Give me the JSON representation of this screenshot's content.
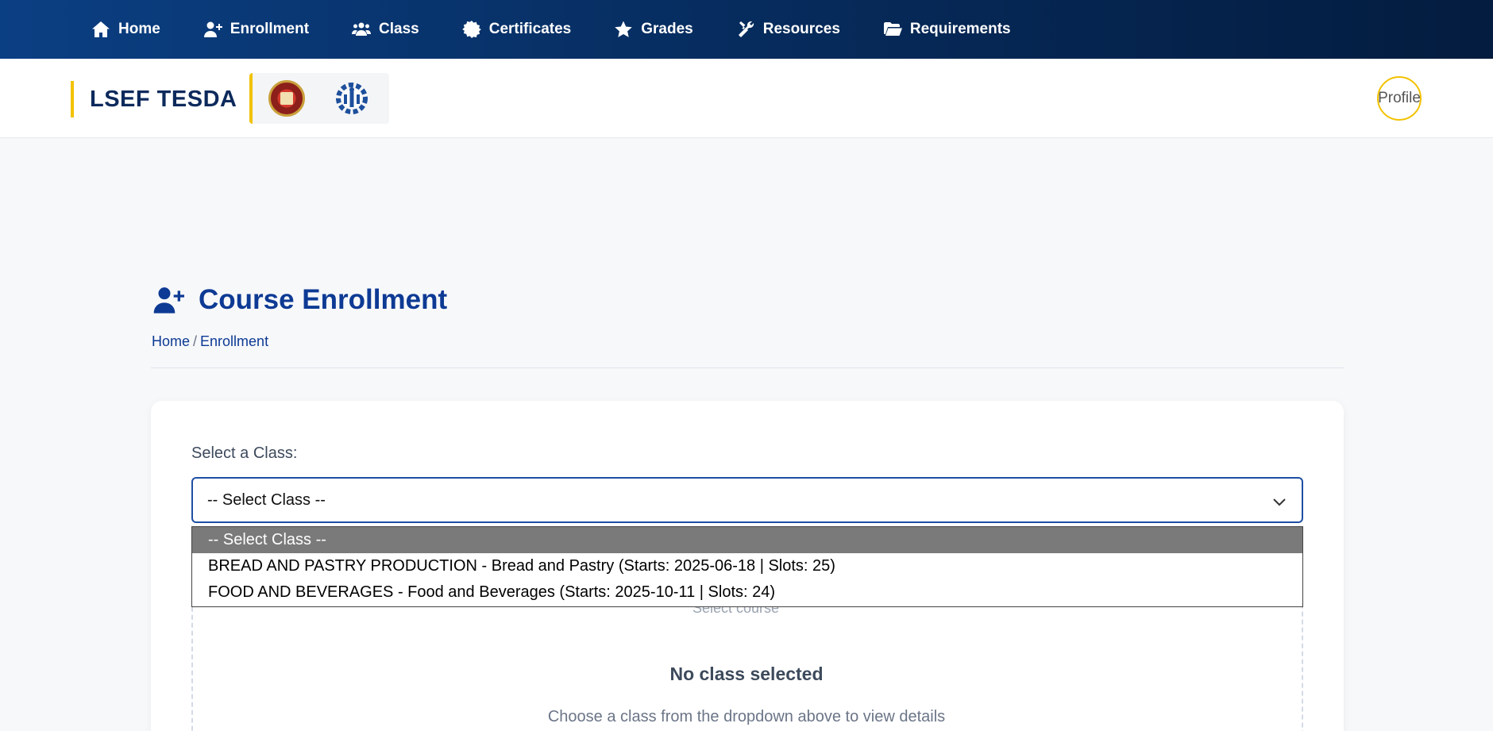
{
  "nav": {
    "items": [
      {
        "label": "Home",
        "icon": "home-icon"
      },
      {
        "label": "Enrollment",
        "icon": "user-plus-icon"
      },
      {
        "label": "Class",
        "icon": "users-icon"
      },
      {
        "label": "Certificates",
        "icon": "certificate-icon"
      },
      {
        "label": "Grades",
        "icon": "star-icon"
      },
      {
        "label": "Resources",
        "icon": "tools-icon"
      },
      {
        "label": "Requirements",
        "icon": "folder-open-icon"
      }
    ]
  },
  "header": {
    "brand": "LSEF TESDA",
    "avatar_alt": "Profile"
  },
  "page": {
    "title": "Course Enrollment",
    "breadcrumb": {
      "home": "Home",
      "separator": "/",
      "current": "Enrollment"
    }
  },
  "form": {
    "label": "Select a Class:",
    "selected": "-- Select Class --",
    "options": [
      "-- Select Class --",
      "BREAD AND PASTRY PRODUCTION - Bread and Pastry (Starts: 2025-06-18 | Slots: 25)",
      "FOOD AND BEVERAGES - Food and Beverages (Starts: 2025-10-11 | Slots: 24)"
    ]
  },
  "empty_state": {
    "image_alt": "Select course",
    "title": "No class selected",
    "subtitle": "Choose a class from the dropdown above to view details"
  },
  "colors": {
    "nav_bg": "#0b3f83",
    "accent": "#f2c200",
    "primary": "#0d3a94"
  }
}
